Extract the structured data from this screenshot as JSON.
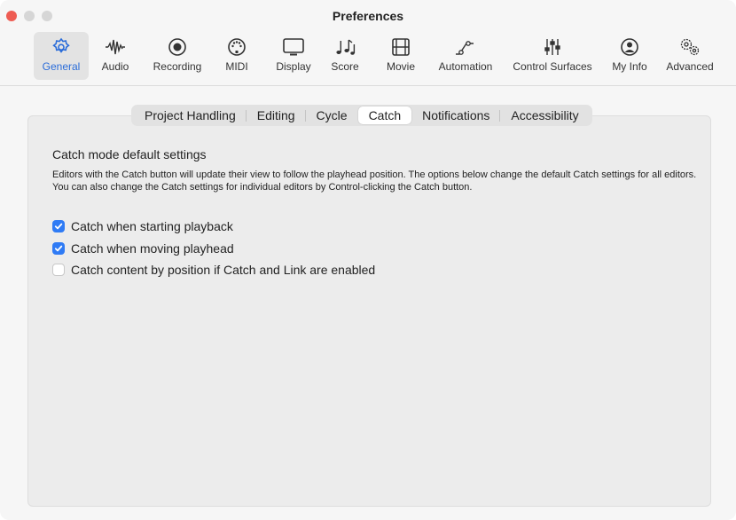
{
  "window": {
    "title": "Preferences"
  },
  "toolbar": {
    "items": [
      {
        "label": "General",
        "icon": "gear-icon",
        "selected": true
      },
      {
        "label": "Audio",
        "icon": "waveform-icon"
      },
      {
        "label": "Recording",
        "icon": "record-icon"
      },
      {
        "label": "MIDI",
        "icon": "midi-port-icon"
      },
      {
        "label": "Display",
        "icon": "monitor-icon"
      },
      {
        "label": "Score",
        "icon": "music-notes-icon"
      },
      {
        "label": "Movie",
        "icon": "film-icon"
      },
      {
        "label": "Automation",
        "icon": "automation-curve-icon"
      },
      {
        "label": "Control Surfaces",
        "icon": "sliders-icon"
      },
      {
        "label": "My Info",
        "icon": "person-circle-icon"
      },
      {
        "label": "Advanced",
        "icon": "gears-icon"
      }
    ]
  },
  "tabs": [
    {
      "label": "Project Handling",
      "active": false
    },
    {
      "label": "Editing",
      "active": false
    },
    {
      "label": "Cycle",
      "active": false
    },
    {
      "label": "Catch",
      "active": true
    },
    {
      "label": "Notifications",
      "active": false
    },
    {
      "label": "Accessibility",
      "active": false
    }
  ],
  "catch": {
    "section_title": "Catch mode default settings",
    "description": "Editors with the Catch button will update their view to follow the playhead position. The options below change the default Catch settings for all editors. You can also change the Catch settings for individual editors by Control-clicking the Catch button.",
    "options": [
      {
        "label": "Catch when starting playback",
        "checked": true
      },
      {
        "label": "Catch when moving playhead",
        "checked": true
      },
      {
        "label": "Catch content by position if Catch and Link are enabled",
        "checked": false
      }
    ]
  },
  "colors": {
    "accent": "#2f7bf5",
    "close": "#ee5c53",
    "selected_label": "#2a6cd9"
  }
}
